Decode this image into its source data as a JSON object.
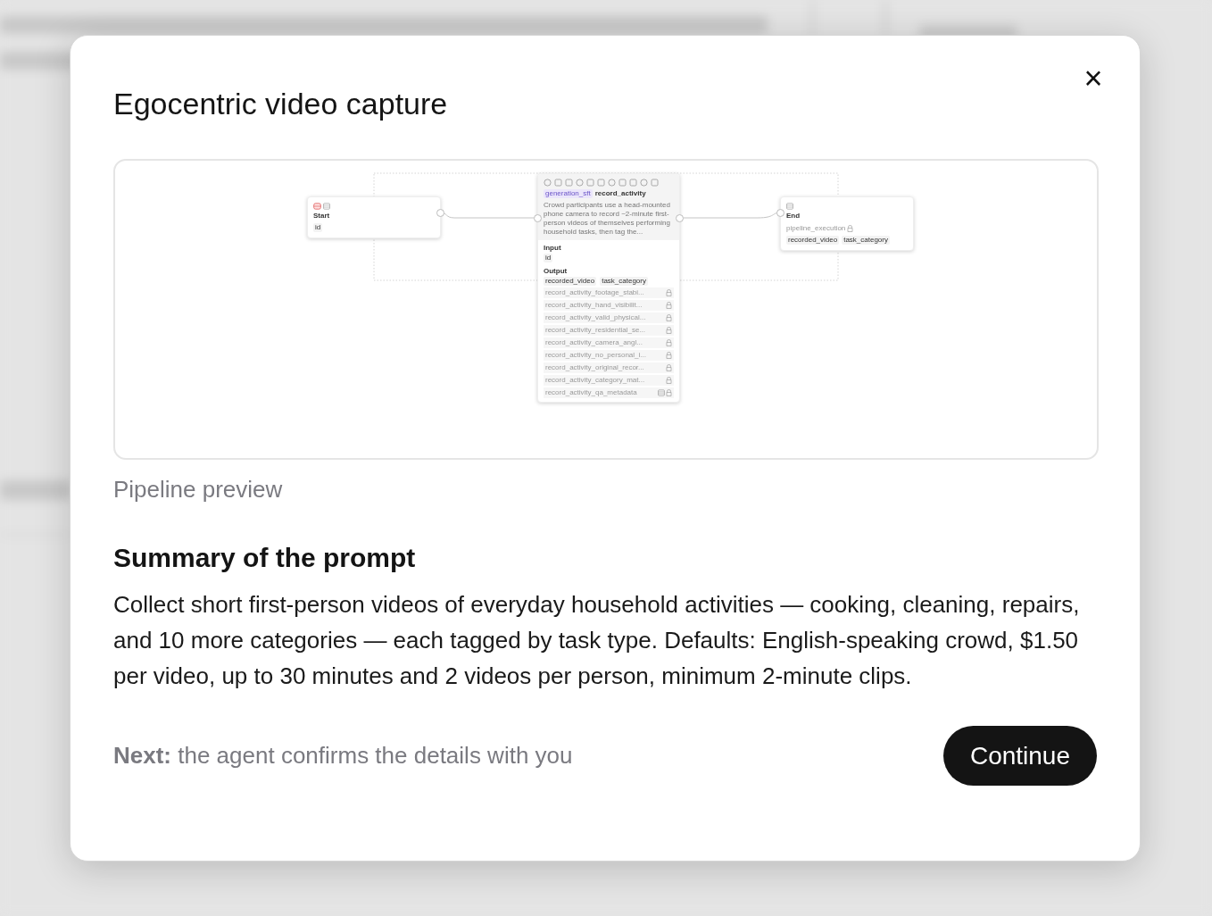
{
  "dialog": {
    "title": "Egocentric video capture",
    "close_label": "×",
    "pipeline": {
      "start": {
        "title": "Start",
        "fields": [
          "id"
        ]
      },
      "step": {
        "tag": "generation_sft",
        "name": "record_activity",
        "description": "Crowd participants use a head-mounted phone camera to record ~2-minute first-person videos of themselves performing household tasks, then tag the...",
        "input_label": "Input",
        "inputs": [
          "id"
        ],
        "output_label": "Output",
        "outputs": [
          "recorded_video",
          "task_category"
        ],
        "locked_outputs": [
          "record_activity_footage_stabi...",
          "record_activity_hand_visibilit...",
          "record_activity_valid_physical...",
          "record_activity_residential_se...",
          "record_activity_camera_angl...",
          "record_activity_no_personal_i...",
          "record_activity_original_recor...",
          "record_activity_category_mat...",
          "record_activity_qa_metadata"
        ]
      },
      "end": {
        "title": "End",
        "locked_field": "pipeline_execution",
        "fields": [
          "recorded_video",
          "task_category"
        ]
      }
    },
    "caption": "Pipeline preview",
    "summary_heading": "Summary of the prompt",
    "summary": "Collect short first-person videos of everyday household activities — cooking, cleaning, repairs, and 10 more categories — each tagged by task type. Defaults: English-speaking crowd, $1.50 per video, up to 30 minutes and 2 videos per person, minimum 2-minute clips.",
    "next_note": "**Next:** the agent confirms the details with you",
    "button": "Continue"
  }
}
